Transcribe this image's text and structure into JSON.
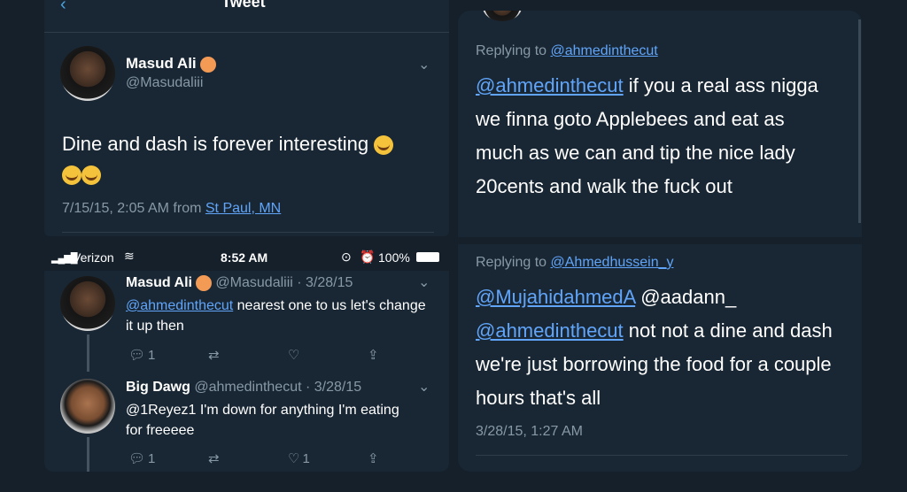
{
  "top_left": {
    "header_title": "Tweet",
    "author_name": "Masud Ali",
    "author_handle": "@Masudaliii",
    "text": "Dine and dash is forever interesting",
    "timestamp": "7/15/15, 2:05 AM from",
    "location": "St Paul, MN"
  },
  "top_right": {
    "replying_label": "Replying to",
    "replying_handle": "@ahmedinthecut",
    "mention": "@ahmedinthecut",
    "text": " if you a real ass nigga we finna goto Applebees and eat as much as we can and tip the nice lady 20cents and walk the fuck out"
  },
  "bottom_left": {
    "status_bar": {
      "carrier": "Verizon",
      "time": "8:52 AM",
      "battery": "100%"
    },
    "tweet1": {
      "name": "Masud Ali",
      "handle_date": "@Masudaliii · 3/28/15",
      "mention": "@ahmedinthecut",
      "text": " nearest one to us let's change it up then",
      "reply_count": "1",
      "like_count": ""
    },
    "tweet2": {
      "name": "Big Dawg",
      "handle_date": "@ahmedinthecut · 3/28/15",
      "text": "@1Reyez1 I'm down for anything I'm eating for freeeee",
      "reply_count": "1",
      "like_count": "1"
    }
  },
  "bottom_right": {
    "replying_label": "Replying to",
    "replying_handle": "@Ahmedhussein_y",
    "mention1": "@MujahidahmedA",
    "mention2": " @aadann_",
    "mention3": "@ahmedinthecut",
    "text": " not not a dine and dash we're just borrowing the food for a couple hours that's all",
    "timestamp": "3/28/15, 1:27 AM"
  }
}
